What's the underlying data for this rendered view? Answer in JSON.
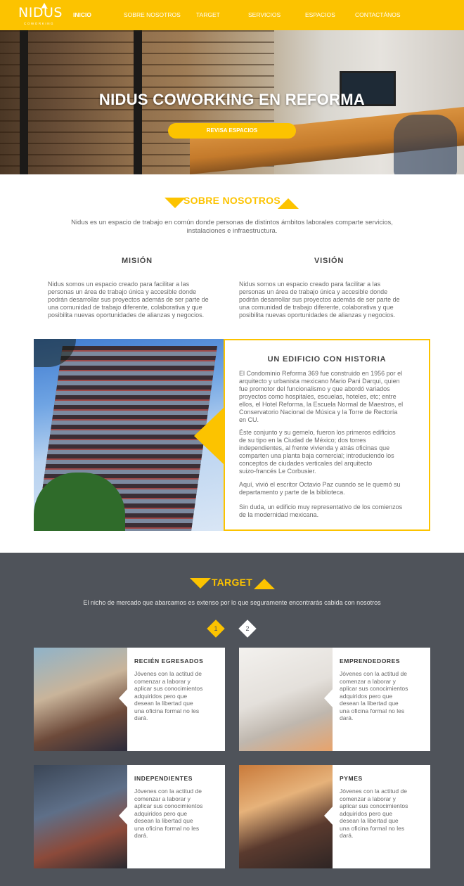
{
  "colors": {
    "accent": "#fcc300",
    "dark_section": "#4f535a",
    "text": "#666666"
  },
  "nav": {
    "logo_text": "NIDUS",
    "logo_sub": "COWORKING",
    "items": [
      {
        "label": "INICIO"
      },
      {
        "label": "SOBRE NOSOTROS"
      },
      {
        "label": "TARGET"
      },
      {
        "label": "SERVICIOS"
      },
      {
        "label": "ESPACIOS"
      },
      {
        "label": "CONTACTÁNOS"
      }
    ]
  },
  "hero": {
    "title": "NIDUS COWORKING EN REFORMA",
    "button": "REVISA ESPACIOS"
  },
  "about": {
    "title": "SOBRE NOSOTROS",
    "intro_line1": "Nidus es un espacio de trabajo en común donde personas de distintos ámbitos laborales comparte servicios,",
    "intro_line2": "instalaciones e infraestructura.",
    "mision": {
      "title": "MISIÓN",
      "lines": [
        "Nidus somos un espacio creado para facilitar a las",
        "personas un área de trabajo única y accesible donde",
        "podrán desarrollar sus proyectos además de ser parte de",
        "una comunidad de trabajo diferente, colaborativa y que",
        "posibilita nuevas oportunidades de alianzas y negocios."
      ]
    },
    "vision": {
      "title": "VISIÓN",
      "lines": [
        "Nidus somos un espacio creado para facilitar a las",
        "personas un área de trabajo única y accesible donde",
        "podrán desarrollar sus proyectos además de ser parte de",
        "una comunidad de trabajo diferente, colaborativa y que",
        "posibilita nuevas oportunidades de alianzas y negocios."
      ]
    }
  },
  "history": {
    "title": "UN EDIFICIO CON HISTORIA",
    "p1": [
      "El Condominio Reforma 369 fue construido en 1956 por el",
      "arquitecto y urbanista mexicano Mario Pani Darqui, quien",
      "fue promotor del funcionalismo y que abordó variados",
      "proyectos como hospitales, escuelas, hoteles, etc; entre",
      "ellos, el Hotel Reforma, la Escuela Normal de Maestros, el",
      "Conservatorio Nacional de Música y la Torre de Rectoría",
      "en CU."
    ],
    "p2": [
      "Éste conjunto y su gemelo, fueron los primeros edificios",
      "de su tipo en la Ciudad de México; dos torres",
      "independientes, al frente vivienda y atrás oficinas que",
      "comparten una planta baja comercial; introduciendo los",
      "conceptos de ciudades verticales del arquitecto",
      "suizo-francés Le Corbusier."
    ],
    "p3": [
      "Aquí, vivió el escritor Octavio Paz cuando se le quemó su",
      "departamento y parte de la biblioteca."
    ],
    "p4": [
      "Sin duda, un edificio muy representativo de los comienzos",
      "de la modernidad mexicana."
    ]
  },
  "target": {
    "title": "TARGET",
    "intro": "El nicho de mercado que abarcamos es extenso por lo que seguramente encontrarás cabida con nosotros",
    "pages": [
      "1",
      "2"
    ],
    "cards": [
      {
        "title": "RECIÉN EGRESADOS",
        "lines": [
          "Jóvenes con la actitud de",
          "comenzar a laborar y",
          "aplicar sus conocimientos",
          "adquiridos pero que",
          "desean la libertad que",
          "una oficina formal no les",
          "dará."
        ]
      },
      {
        "title": "EMPRENDEDORES",
        "lines": [
          "Jóvenes con la actitud de",
          "comenzar a laborar y",
          "aplicar sus conocimientos",
          "adquiridos pero que",
          "desean la libertad que",
          "una oficina formal no les",
          "dará."
        ]
      },
      {
        "title": "INDEPENDIENTES",
        "lines": [
          "Jóvenes con la actitud de",
          "comenzar a laborar y",
          "aplicar sus conocimientos",
          "adquiridos pero que",
          "desean la libertad que",
          "una oficina formal no les",
          "dará."
        ]
      },
      {
        "title": "PYMES",
        "lines": [
          "Jóvenes con la actitud de",
          "comenzar a laborar y",
          "aplicar sus conocimientos",
          "adquiridos pero que",
          "desean la libertad que",
          "una oficina formal no les",
          "dará."
        ]
      }
    ]
  }
}
